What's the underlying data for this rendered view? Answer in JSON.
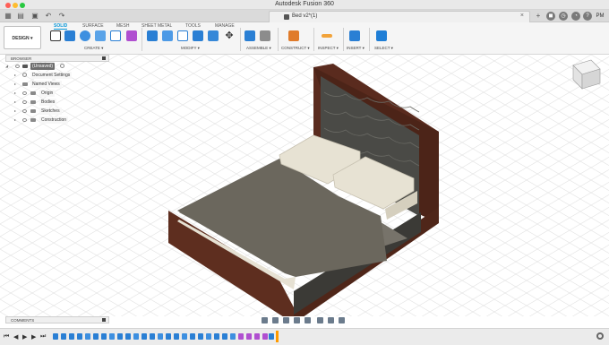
{
  "app_title": "Autodesk Fusion 360",
  "document_tab": {
    "name": "Bed v2*(1)",
    "close": "×"
  },
  "ribbon": {
    "workspace": "DESIGN ▾",
    "tabs": [
      "SOLID",
      "SURFACE",
      "MESH",
      "SHEET METAL",
      "TOOLS",
      "MANAGE"
    ],
    "active_tab": "SOLID",
    "groups": [
      "CREATE ▾",
      "MODIFY ▾",
      "ASSEMBLE ▾",
      "CONSTRUCT ▾",
      "INSPECT ▾",
      "INSERT ▾",
      "SELECT ▾"
    ]
  },
  "browser": {
    "title": "BROWSER",
    "root": "(Unsaved)",
    "items": [
      "Document Settings",
      "Named Views",
      "Origin",
      "Bodies",
      "Sketches",
      "Construction"
    ]
  },
  "comments": {
    "title": "COMMENTS"
  },
  "user": {
    "initials": "PM"
  },
  "colors": {
    "accent": "#0696d7",
    "wood": "#5a2b1e",
    "fabric": "#6b675d",
    "pillow": "#e7e2d3",
    "headboard": "#4a4a46",
    "timeline_marker": "#ff9b00"
  },
  "icons": [
    "grid-icon",
    "file-icon",
    "save-icon",
    "undo-icon",
    "redo-icon",
    "new-tab-icon",
    "extensions-icon",
    "job-status-icon",
    "notifications-icon",
    "help-icon",
    "view-cube-icon",
    "orbit-icon",
    "pan-icon",
    "zoom-icon",
    "display-settings-icon",
    "play-icon",
    "settings-icon"
  ]
}
